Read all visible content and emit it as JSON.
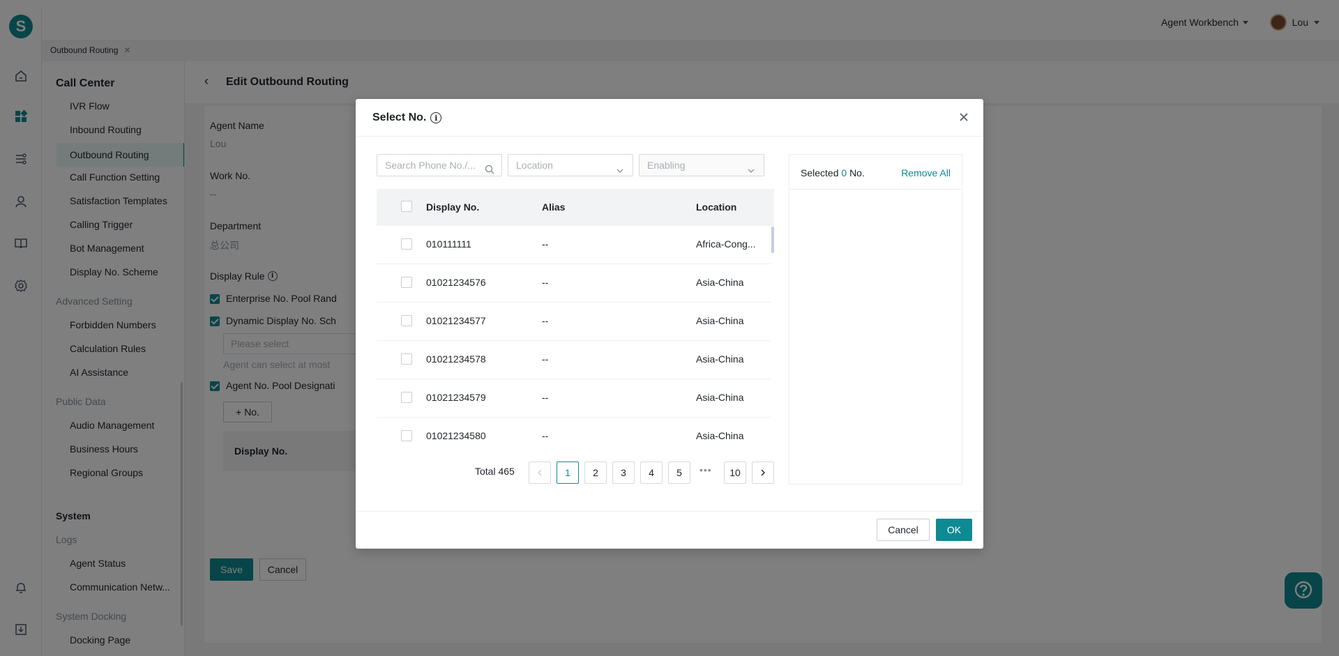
{
  "header": {
    "workbench_label": "Agent Workbench",
    "user_name": "Lou"
  },
  "rail": {
    "logo_letter": "S"
  },
  "tabs": [
    {
      "label": "Outbound Routing"
    }
  ],
  "sidebar": {
    "title": "Call Center",
    "items_top": [
      "IVR Flow",
      "Inbound Routing",
      "Outbound Routing",
      "Call Function Setting",
      "Satisfaction Templates",
      "Calling Trigger",
      "Bot Management",
      "Display No. Scheme"
    ],
    "group_advanced": "Advanced Setting",
    "items_advanced": [
      "Forbidden Numbers",
      "Calculation Rules",
      "AI Assistance"
    ],
    "group_public": "Public Data",
    "items_public": [
      "Audio Management",
      "Business Hours",
      "Regional Groups"
    ],
    "section_system": "System",
    "group_logs": "Logs",
    "items_logs": [
      "Agent Status",
      "Communication Netw..."
    ],
    "group_docking": "System Docking",
    "items_docking": [
      "Docking Page"
    ]
  },
  "page": {
    "title": "Edit Outbound Routing",
    "agent_name_label": "Agent Name",
    "agent_name_value": "Lou",
    "work_no_label": "Work No.",
    "work_no_value": "--",
    "department_label": "Department",
    "department_value": "总公司",
    "display_rule_label": "Display Rule",
    "rule_enterprise": "Enterprise No. Pool Rand",
    "rule_dynamic": "Dynamic Display No. Sch",
    "select_placeholder": "Please select",
    "select_hint": "Agent can select at most",
    "rule_agent_pool": "Agent No. Pool Designati",
    "add_no_label": "No.",
    "display_no_header": "Display No.",
    "save_label": "Save",
    "cancel_label": "Cancel"
  },
  "modal": {
    "title": "Select No.",
    "search_placeholder": "Search Phone No./...",
    "location_placeholder": "Location",
    "enabling_placeholder": "Enabling",
    "columns": {
      "display_no": "Display No.",
      "alias": "Alias",
      "location": "Location"
    },
    "rows": [
      {
        "no": "010111111",
        "alias": "--",
        "location": "Africa-Cong..."
      },
      {
        "no": "01021234576",
        "alias": "--",
        "location": "Asia-China"
      },
      {
        "no": "01021234577",
        "alias": "--",
        "location": "Asia-China"
      },
      {
        "no": "01021234578",
        "alias": "--",
        "location": "Asia-China"
      },
      {
        "no": "01021234579",
        "alias": "--",
        "location": "Asia-China"
      },
      {
        "no": "01021234580",
        "alias": "--",
        "location": "Asia-China"
      }
    ],
    "total_label": "Total 465",
    "pages": [
      "1",
      "2",
      "3",
      "4",
      "5",
      "10"
    ],
    "ellipsis": "•••",
    "selected_prefix": "Selected",
    "selected_count": "0",
    "selected_suffix": "No.",
    "remove_all": "Remove All",
    "cancel_label": "Cancel",
    "ok_label": "OK"
  },
  "colors": {
    "accent": "#0e8a93",
    "overlay": "rgba(0,0,0,0.5)"
  }
}
